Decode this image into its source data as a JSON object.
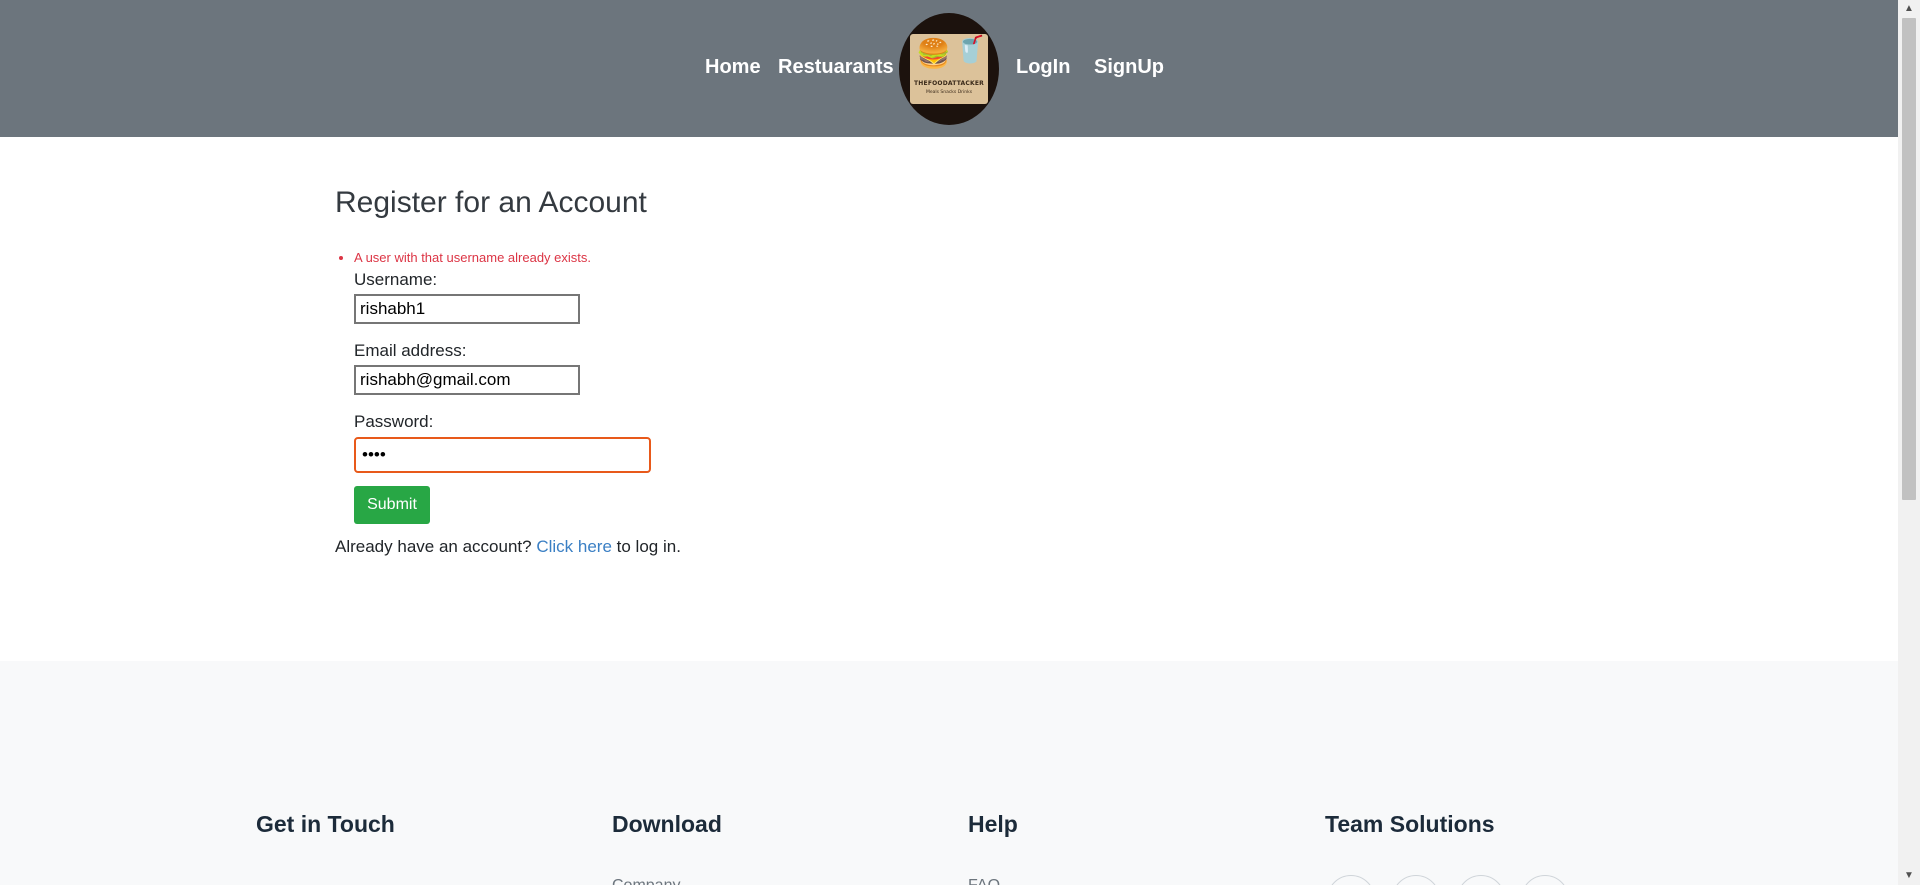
{
  "navbar": {
    "links": {
      "home": "Home",
      "restaurants": "Restuarants",
      "login": "LogIn",
      "signup": "SignUp"
    },
    "logo": {
      "brand": "THEFOODATTACKER",
      "tagline": "Meals Snacks Drinks"
    },
    "background": "#6c757d"
  },
  "register": {
    "title": "Register for an Account",
    "errors": [
      "A user with that username already exists."
    ],
    "username_label": "Username:",
    "username_value": "rishabh1",
    "email_label": "Email address:",
    "email_value": "rishabh@gmail.com",
    "password_label": "Password:",
    "password_value": "pass",
    "submit_label": "Submit",
    "login_prompt_before": "Already have an account?",
    "login_link": "Click here",
    "login_prompt_after": "to log in."
  },
  "footer": {
    "columns": [
      {
        "heading": "Get in Touch",
        "first_link": ""
      },
      {
        "heading": "Download",
        "first_link": "Company"
      },
      {
        "heading": "Help",
        "first_link": "FAQ"
      },
      {
        "heading": "Team Solutions",
        "first_link": ""
      }
    ],
    "social_icons": [
      "facebook-icon",
      "twitter-icon",
      "instagram-icon",
      "linkedin-icon"
    ]
  },
  "colors": {
    "accent_green": "#28a745",
    "error_red": "#dc3545",
    "link_blue": "#3a7fc4",
    "focus_orange": "#e8591a"
  }
}
